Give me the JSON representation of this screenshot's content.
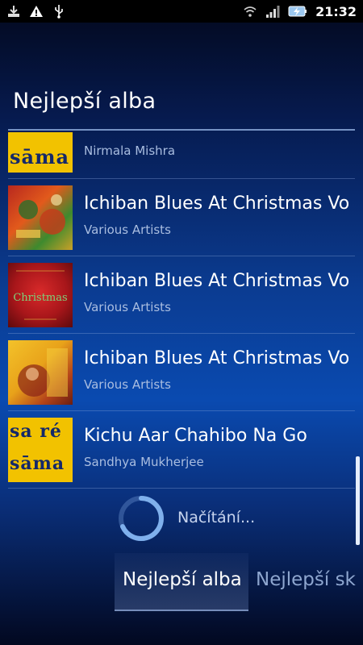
{
  "status_bar": {
    "time": "21:32",
    "left_icons": [
      "download-icon",
      "warning-icon",
      "usb-icon"
    ],
    "right_icons": [
      "wifi-icon",
      "signal-icon",
      "battery-charging-icon"
    ]
  },
  "header": {
    "title": "Nejlepší alba"
  },
  "albums": [
    {
      "title": "",
      "artist": "Nirmala Mishra",
      "cover": "saregama",
      "cover_text": "sāma"
    },
    {
      "title": "Ichiban Blues At Christmas Vo",
      "artist": "Various Artists",
      "cover": "christmas-1"
    },
    {
      "title": "Ichiban Blues At Christmas Vo",
      "artist": "Various Artists",
      "cover": "christmas-2",
      "cover_text": "Christmas"
    },
    {
      "title": "Ichiban Blues At Christmas Vo",
      "artist": "Various Artists",
      "cover": "christmas-3"
    },
    {
      "title": "Kichu Aar Chahibo Na Go",
      "artist": "Sandhya Mukherjee",
      "cover": "saregama",
      "cover_text_top": "sa ré",
      "cover_text_bottom": "sāma"
    }
  ],
  "loading": {
    "text": "Načítání..."
  },
  "tabs": [
    {
      "label": "Nejlepší alba",
      "active": true
    },
    {
      "label": "Nejlepší sk",
      "active": false
    }
  ],
  "colors": {
    "accent": "#0a4ab0",
    "secondary_text": "#a9bde0"
  }
}
